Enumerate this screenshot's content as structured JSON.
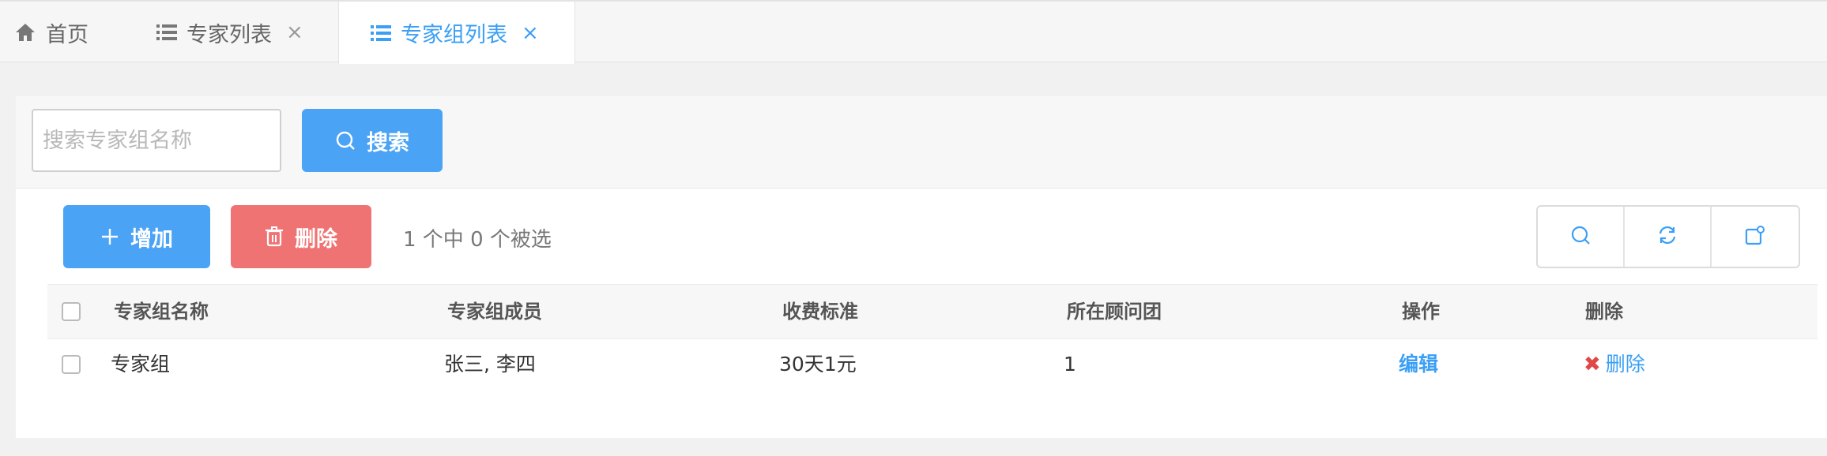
{
  "tabs": [
    {
      "label": "首页",
      "icon": "home-icon",
      "closable": false
    },
    {
      "label": "专家列表",
      "icon": "list-icon",
      "closable": true
    },
    {
      "label": "专家组列表",
      "icon": "list-icon",
      "closable": true,
      "active": true
    }
  ],
  "tab_close_glyph": "×",
  "search": {
    "placeholder": "搜索专家组名称",
    "button_label": "搜索"
  },
  "toolbar": {
    "add_label": "增加",
    "delete_label": "删除",
    "selection_info": "1 个中 0 个被选",
    "tools": [
      "search-icon",
      "refresh-icon",
      "export-icon"
    ]
  },
  "table": {
    "headers": [
      "专家组名称",
      "专家组成员",
      "收费标准",
      "所在顾问团",
      "操作",
      "删除"
    ],
    "rows": [
      {
        "name": "专家组",
        "members": "张三, 李四",
        "fee": "30天1元",
        "group": "1",
        "action": "编辑",
        "delete": "删除"
      }
    ]
  },
  "colors": {
    "accent": "#3a9ff5",
    "primary_button": "#4aa3f5",
    "danger_button": "#f07373",
    "delete_x": "#e04747"
  }
}
